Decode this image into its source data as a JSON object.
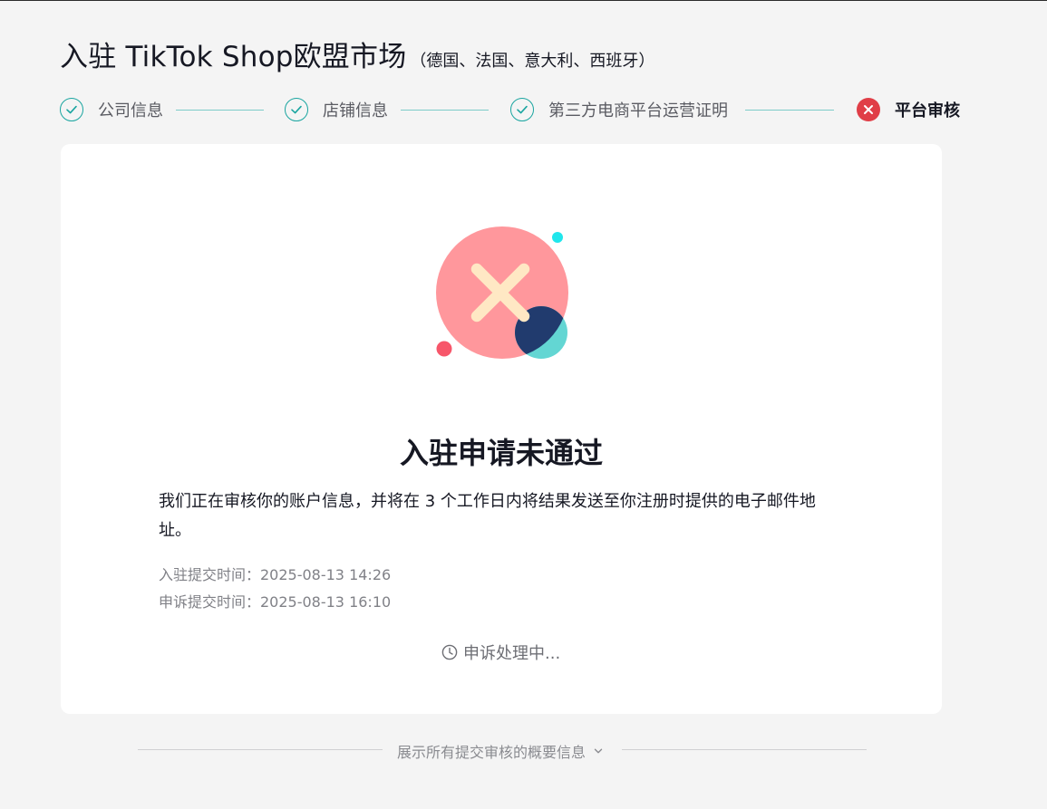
{
  "header": {
    "title": "入驻 TikTok Shop欧盟市场",
    "subtitle": "（德国、法国、意大利、西班牙）"
  },
  "steps": [
    {
      "label": "公司信息",
      "status": "done"
    },
    {
      "label": "店铺信息",
      "status": "done"
    },
    {
      "label": "第三方电商平台运营证明",
      "status": "done"
    },
    {
      "label": "平台审核",
      "status": "failed"
    }
  ],
  "result": {
    "title": "入驻申请未通过",
    "description": "我们正在审核你的账户信息，并将在 3 个工作日内将结果发送至你注册时提供的电子邮件地址。",
    "submit_time": "入驻提交时间：2025-08-13 14:26",
    "appeal_time": "申诉提交时间：2025-08-13 16:10",
    "appeal_status": "申诉处理中..."
  },
  "summary_toggle": {
    "label": "展示所有提交审核的概要信息"
  },
  "colors": {
    "step_done": "#1aa5a0",
    "step_failed": "#e03e47",
    "background": "#f4f4f4"
  }
}
